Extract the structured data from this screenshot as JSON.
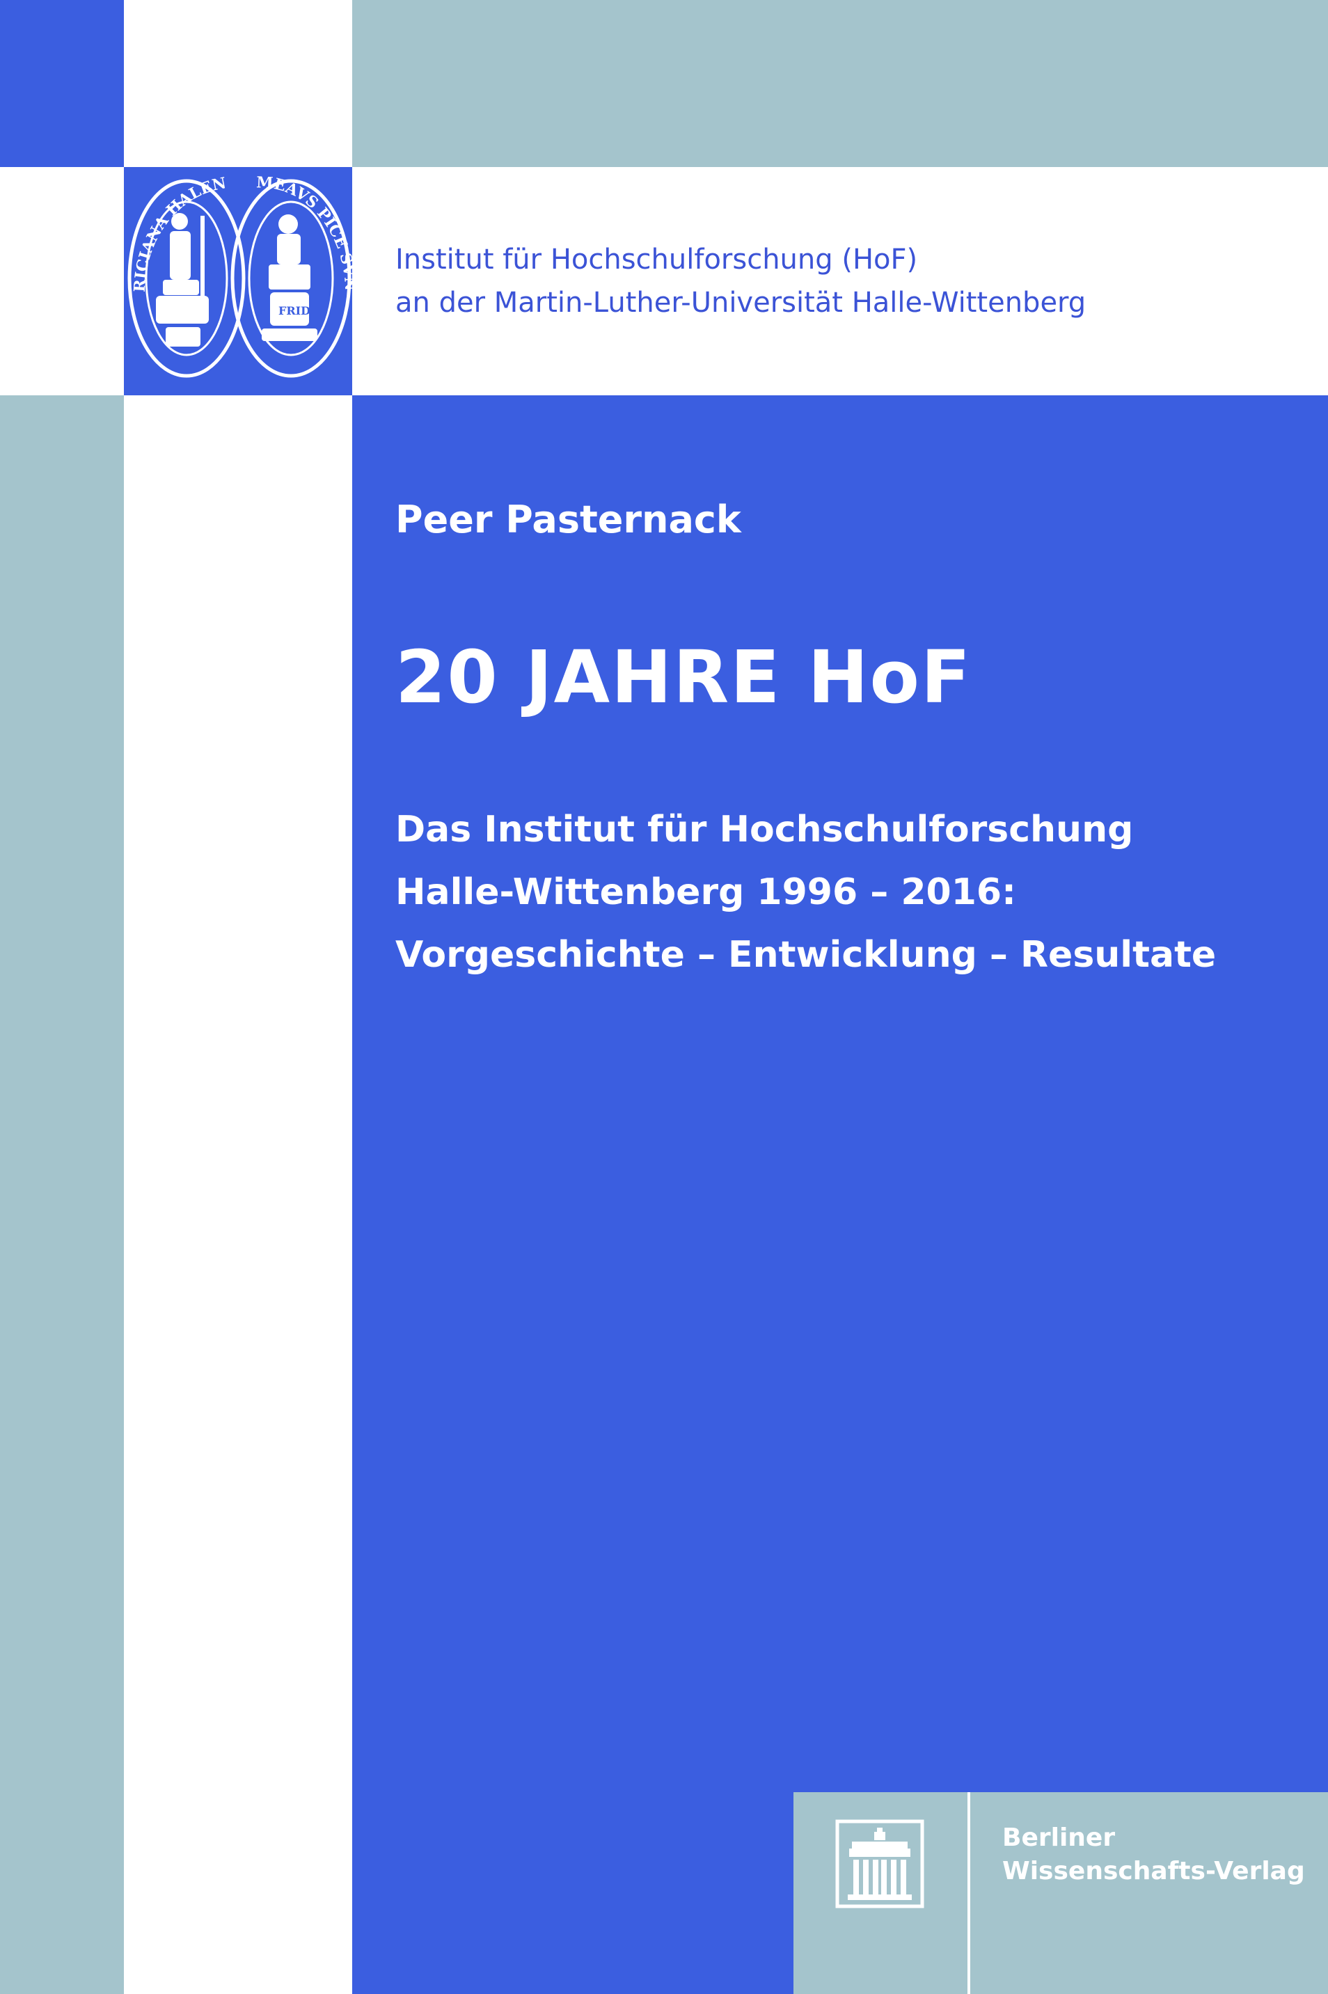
{
  "colors": {
    "blue": "#3b5ee0",
    "teal": "#a4c4cc",
    "white": "#ffffff",
    "institute_text": "#3b53d6"
  },
  "institute": {
    "line_1": "Institut für Hochschulforschung (HoF)",
    "line_2": "an der Martin-Luther-Universität Halle-Wittenberg"
  },
  "seal": {
    "left_inscription": "RICIANA HALENS",
    "right_inscription": "MEAVS PICE SVNIVER DOCERE WITTEBERG",
    "right_motto": "FRID"
  },
  "author": "Peer Pasternack",
  "title": "20 JAHRE  HoF",
  "subtitle": [
    "Das Institut für Hochschulforschung",
    "Halle-Wittenberg 1996 – 2016:",
    "Vorgeschichte – Entwicklung – Resultate"
  ],
  "publisher": {
    "line_1": "Berliner",
    "line_2": "Wissenschafts-Verlag",
    "logo_icon": "brandenburg-gate-icon"
  }
}
